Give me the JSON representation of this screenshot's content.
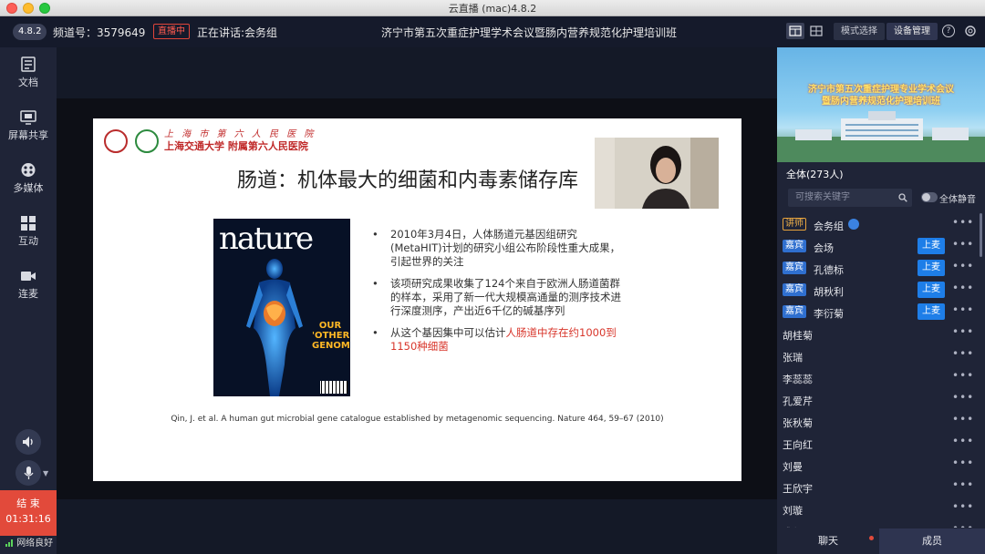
{
  "window": {
    "title": "云直播 (mac)4.8.2"
  },
  "topbar": {
    "version": "4.8.2",
    "channel_label": "频道号：3579649",
    "live_badge": "直播中",
    "speaking_label": "正在讲话:会务组",
    "meeting_title": "济宁市第五次重症护理学术会议暨肠内营养规范化护理培训班",
    "mode_select": "模式选择",
    "device_manage": "设备管理"
  },
  "sidebar": {
    "items": [
      {
        "label": "文档",
        "icon": "document-icon"
      },
      {
        "label": "屏幕共享",
        "icon": "screen-share-icon"
      },
      {
        "label": "多媒体",
        "icon": "media-icon"
      },
      {
        "label": "互动",
        "icon": "grid-icon"
      },
      {
        "label": "连麦",
        "icon": "camera-icon"
      }
    ],
    "end_label": "结 束",
    "end_time": "01:31:16",
    "network": "网络良好"
  },
  "slide": {
    "hospital_line1": "上 海 市 第 六 人 民 医 院",
    "hospital_line2": "上海交通大学 附属第六人民医院",
    "title": "肠道：机体最大的细菌和内毒素储存库",
    "cover_masthead": "nature",
    "cover_headline": "OUR 'OTHER' GENOME",
    "bullets": [
      {
        "text": "2010年3月4日，人体肠道元基因组研究(MetaHIT)计划的研究小组公布阶段性重大成果，引起世界的关注",
        "highlight": ""
      },
      {
        "text": "该项研究成果收集了124个来自于欧洲人肠道菌群的样本，采用了新一代大规模高通量的测序技术进行深度测序，产出近6千亿的碱基序列",
        "highlight": ""
      },
      {
        "text": "从这个基因集中可以估计",
        "highlight": "人肠道中存在约1000到1150种细菌"
      }
    ],
    "citation": "Qin, J. et al. A human gut microbial gene catalogue established by metagenomic sequencing. Nature 464, 59–67 (2010)"
  },
  "rightpanel": {
    "banner_line1": "济宁市第五次重症护理专业学术会议",
    "banner_line2": "暨肠内营养规范化护理培训班",
    "all_count": "全体(273人)",
    "search_placeholder": "可搜索关键字",
    "mute_all": "全体静音",
    "members": [
      {
        "tag": "讲师",
        "tag_type": "teacher",
        "name": "会务组",
        "mic": "",
        "me": true
      },
      {
        "tag": "嘉宾",
        "tag_type": "guest",
        "name": "会场",
        "mic": "上麦"
      },
      {
        "tag": "嘉宾",
        "tag_type": "guest",
        "name": "孔德标",
        "mic": "上麦"
      },
      {
        "tag": "嘉宾",
        "tag_type": "guest",
        "name": "胡秋利",
        "mic": "上麦"
      },
      {
        "tag": "嘉宾",
        "tag_type": "guest",
        "name": "李衍菊",
        "mic": "上麦"
      },
      {
        "tag": "",
        "name": "胡桂菊",
        "mic": ""
      },
      {
        "tag": "",
        "name": "张瑞",
        "mic": ""
      },
      {
        "tag": "",
        "name": "李蕊蕊",
        "mic": ""
      },
      {
        "tag": "",
        "name": "孔爱芹",
        "mic": ""
      },
      {
        "tag": "",
        "name": "张秋菊",
        "mic": ""
      },
      {
        "tag": "",
        "name": "王向红",
        "mic": ""
      },
      {
        "tag": "",
        "name": "刘曼",
        "mic": ""
      },
      {
        "tag": "",
        "name": "王欣宇",
        "mic": ""
      },
      {
        "tag": "",
        "name": "刘璇",
        "mic": ""
      },
      {
        "tag": "",
        "name": "盛馨",
        "mic": ""
      }
    ],
    "more_glyph": "•••",
    "tabs": [
      {
        "label": "聊天"
      },
      {
        "label": "成员"
      }
    ]
  }
}
